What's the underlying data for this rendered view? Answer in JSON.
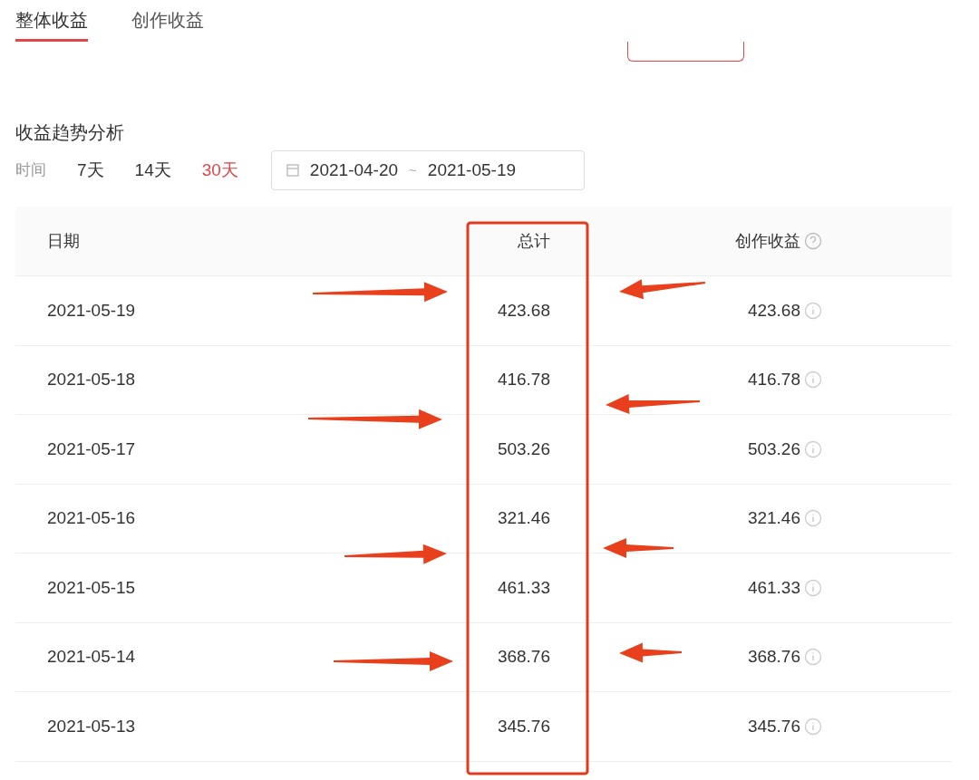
{
  "tabs": [
    {
      "label": "整体收益",
      "selected": true
    },
    {
      "label": "创作收益",
      "selected": false
    }
  ],
  "section_title": "收益趋势分析",
  "filter": {
    "label": "时间",
    "periods": [
      {
        "label": "7天",
        "selected": false
      },
      {
        "label": "14天",
        "selected": false
      },
      {
        "label": "30天",
        "selected": true
      }
    ],
    "date_start": "2021-04-20",
    "separator": "~",
    "date_end": "2021-05-19"
  },
  "table": {
    "columns": [
      "日期",
      "总计",
      "创作收益"
    ],
    "rows": [
      [
        "2021-05-19",
        "423.68",
        "423.68"
      ],
      [
        "2021-05-18",
        "416.78",
        "416.78"
      ],
      [
        "2021-05-17",
        "503.26",
        "503.26"
      ],
      [
        "2021-05-16",
        "321.46",
        "321.46"
      ],
      [
        "2021-05-15",
        "461.33",
        "461.33"
      ],
      [
        "2021-05-14",
        "368.76",
        "368.76"
      ],
      [
        "2021-05-13",
        "345.76",
        "345.76"
      ]
    ]
  }
}
